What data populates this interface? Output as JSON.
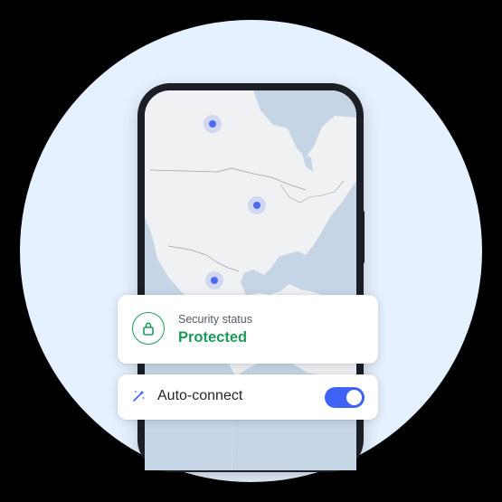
{
  "security_card": {
    "label": "Security status",
    "status": "Protected",
    "status_color": "#1d9a5b",
    "icon": "lock-icon"
  },
  "auto_connect": {
    "label": "Auto-connect",
    "enabled": true,
    "icon": "magic-wand-icon",
    "toggle_color": "#3e63f5"
  },
  "map": {
    "pin_color": "#4a6cf0",
    "land_color": "#f0f1f3",
    "water_color": "#c6d5e6"
  },
  "background_color": "#e5f1fe"
}
